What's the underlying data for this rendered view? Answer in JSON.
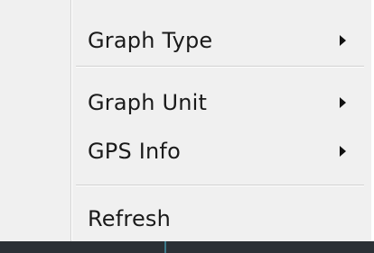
{
  "context_menu": {
    "items": [
      {
        "label": "Graph Type",
        "has_submenu": true,
        "submenu_icon": "submenu-arrow-icon"
      },
      {
        "label": "Graph Unit",
        "has_submenu": true,
        "submenu_icon": "submenu-arrow-icon"
      },
      {
        "label": "GPS Info",
        "has_submenu": true,
        "submenu_icon": "submenu-arrow-icon"
      },
      {
        "label": "Refresh",
        "has_submenu": false
      }
    ]
  },
  "colors": {
    "menu_background": "#f0f0f0",
    "text": "#1a1a1a",
    "separator": "#d0d0d0",
    "underlying_window": "#2b3035"
  }
}
